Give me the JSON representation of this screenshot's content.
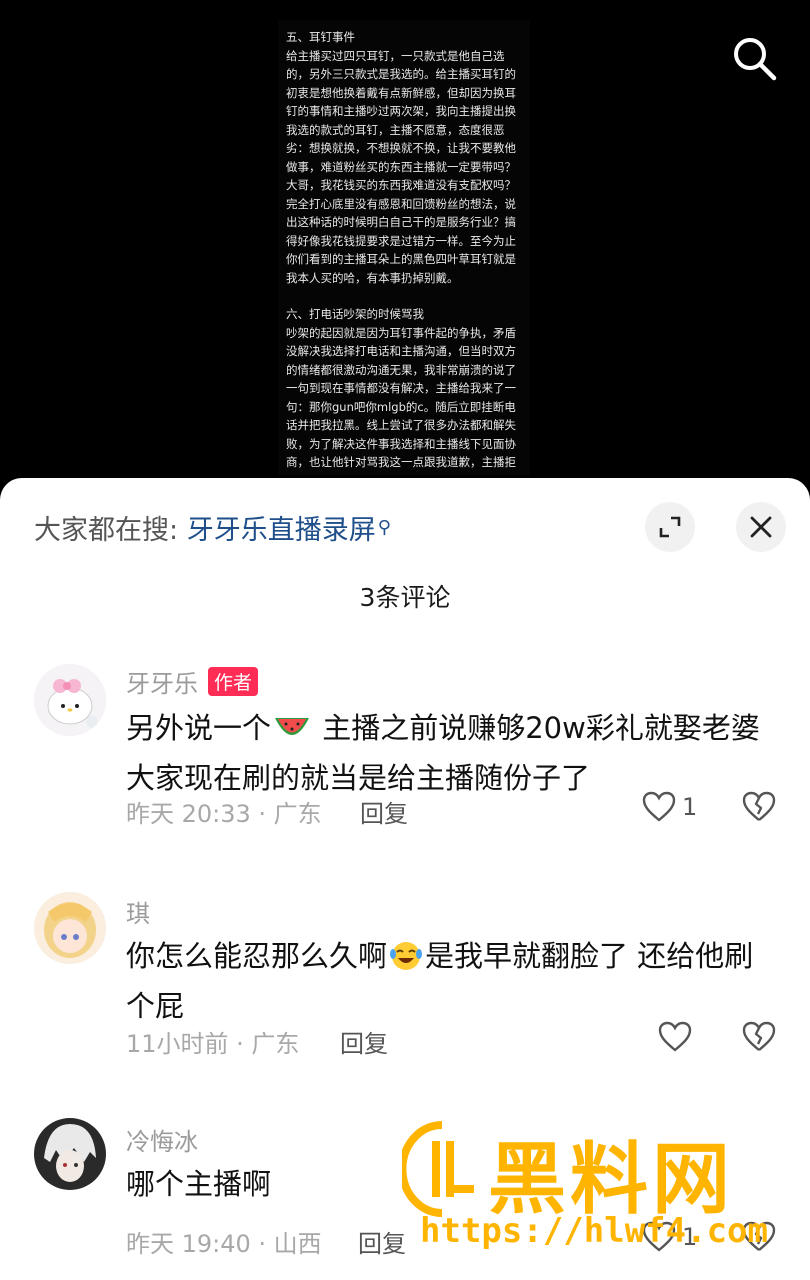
{
  "article": {
    "section5_title": "五、耳钉事件",
    "section5_body": "给主播买过四只耳钉，一只款式是他自己选的，另外三只款式是我选的。给主播买耳钉的初衷是想他换着戴有点新鲜感，但却因为换耳钉的事情和主播吵过两次架，我向主播提出换我选的款式的耳钉，主播不愿意，态度很恶劣：想换就换，不想换就不换，让我不要教他做事，难道粉丝买的东西主播就一定要带吗？大哥，我花钱买的东西我难道没有支配权吗？完全打心底里没有感恩和回馈粉丝的想法，说出这种话的时候明白自己干的是服务行业？搞得好像我花钱提要求是过错方一样。至今为止你们看到的主播耳朵上的黑色四叶草耳钉就是我本人买的哈，有本事扔掉别戴。",
    "section6_title": "六、打电话吵架的时候骂我",
    "section6_body": "吵架的起因就是因为耳钉事件起的争执，矛盾没解决我选择打电话和主播沟通，但当时双方的情绪都很激动沟通无果，我非常崩溃的说了一句到现在事情都没有解决，主播给我来了一句：那你gun吧你mlgb的c。随后立即挂断电话并把我拉黑。线上尝试了很多办法都和解失败，为了解决这件事我选择和主播线下见面协商，也让他针对骂我这一点跟我道歉，主播拒绝跟我道歉。"
  },
  "search": {
    "prefix": "大家都在搜:",
    "query": "牙牙乐直播录屏",
    "query_icon": "search-small-icon"
  },
  "comments_count_label": "3条评论",
  "comments": [
    {
      "username": "牙牙乐",
      "badge": "作者",
      "text_a": "另外说一个",
      "emoji": "watermelon",
      "text_b": " 主播之前说赚够20w彩礼就娶老婆 大家现在刷的就当是给主播随份子了",
      "meta": "昨天 20:33 · 广东",
      "reply": "回复",
      "likes": "1"
    },
    {
      "username": "琪",
      "text_a": "你怎么能忍那么久啊",
      "emoji": "laughing-tears",
      "text_b": "是我早就翻脸了 还给他刷个屁",
      "meta": "11小时前 · 广东",
      "reply": "回复",
      "likes": ""
    },
    {
      "username": "冷悔冰",
      "text_a": "哪个主播啊",
      "meta": "昨天 19:40 · 山西",
      "reply": "回复",
      "likes": "1"
    }
  ],
  "watermark": {
    "title": "黑料网",
    "url": "https://hlwf4.com"
  },
  "colors": {
    "badge": "#ff2c55",
    "search_link": "#1f4f8a",
    "watermark": "#ffb400"
  }
}
